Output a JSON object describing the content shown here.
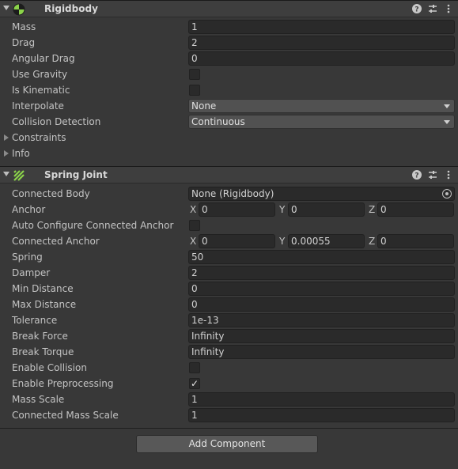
{
  "rigidbody": {
    "title": "Rigidbody",
    "fields": {
      "mass": {
        "label": "Mass",
        "value": "1"
      },
      "drag": {
        "label": "Drag",
        "value": "2"
      },
      "angular_drag": {
        "label": "Angular Drag",
        "value": "0"
      },
      "use_gravity": {
        "label": "Use Gravity",
        "checked": false
      },
      "is_kinematic": {
        "label": "Is Kinematic",
        "checked": false
      },
      "interpolate": {
        "label": "Interpolate",
        "value": "None"
      },
      "collision_detection": {
        "label": "Collision Detection",
        "value": "Continuous"
      },
      "constraints": {
        "label": "Constraints"
      },
      "info": {
        "label": "Info"
      }
    }
  },
  "spring_joint": {
    "title": "Spring Joint",
    "fields": {
      "connected_body": {
        "label": "Connected Body",
        "value": "None (Rigidbody)"
      },
      "anchor": {
        "label": "Anchor",
        "x_label": "X",
        "x": "0",
        "y_label": "Y",
        "y": "0",
        "z_label": "Z",
        "z": "0"
      },
      "auto_configure": {
        "label": "Auto Configure Connected Anchor",
        "checked": false
      },
      "connected_anchor": {
        "label": "Connected Anchor",
        "x_label": "X",
        "x": "0",
        "y_label": "Y",
        "y": "0.00055",
        "z_label": "Z",
        "z": "0"
      },
      "spring": {
        "label": "Spring",
        "value": "50"
      },
      "damper": {
        "label": "Damper",
        "value": "2"
      },
      "min_distance": {
        "label": "Min Distance",
        "value": "0"
      },
      "max_distance": {
        "label": "Max Distance",
        "value": "0"
      },
      "tolerance": {
        "label": "Tolerance",
        "value": "1e-13"
      },
      "break_force": {
        "label": "Break Force",
        "value": "Infinity"
      },
      "break_torque": {
        "label": "Break Torque",
        "value": "Infinity"
      },
      "enable_collision": {
        "label": "Enable Collision",
        "checked": false
      },
      "enable_preprocessing": {
        "label": "Enable Preprocessing",
        "checked": true,
        "check_glyph": "✓"
      },
      "mass_scale": {
        "label": "Mass Scale",
        "value": "1"
      },
      "connected_mass_scale": {
        "label": "Connected Mass Scale",
        "value": "1"
      }
    }
  },
  "add_component": {
    "label": "Add Component"
  },
  "icons": {
    "rigidbody": "rigidbody-icon",
    "spring_joint": "spring-joint-icon",
    "help": "help-icon",
    "presets": "presets-icon",
    "menu": "kebab-menu-icon"
  },
  "colors": {
    "background": "#383838",
    "field": "#2a2a2a",
    "accent_green": "#8bd34a"
  }
}
